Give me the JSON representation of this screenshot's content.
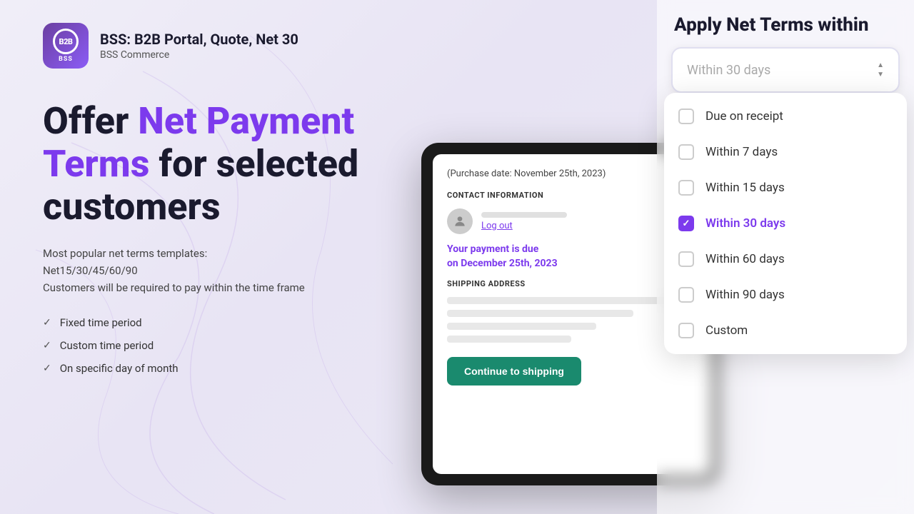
{
  "header": {
    "logo_letters": "B2B",
    "logo_sub": "BSS",
    "app_name": "BSS: B2B Portal, Quote, Net 30",
    "company": "BSS Commerce"
  },
  "hero": {
    "heading_part1": "Offer ",
    "heading_highlight": "Net Payment Terms",
    "heading_part2": " for selected customers",
    "subtext_line1": "Most popular net terms templates:",
    "subtext_line2": "Net15/30/45/60/90",
    "subtext_line3": "Customers will be required to pay within the time frame",
    "features": [
      "Fixed time period",
      "Custom time period",
      "On specific day of month"
    ]
  },
  "tablet": {
    "purchase_date": "(Purchase date: November 25th, 2023)",
    "contact_section": "CONTACT INFORMATION",
    "log_out": "Log out",
    "payment_due_line1": "Your payment is due",
    "payment_due_line2": "on December 25th, 2023",
    "shipping_section": "SHIPPING ADDRESS",
    "continue_btn": "Continue to shipping"
  },
  "dropdown": {
    "title": "Apply Net Terms within",
    "selected_value": "Within 30 days",
    "items": [
      {
        "id": "due-receipt",
        "label": "Due on receipt",
        "checked": false
      },
      {
        "id": "within-7",
        "label": "Within 7 days",
        "checked": false
      },
      {
        "id": "within-15",
        "label": "Within 15 days",
        "checked": false
      },
      {
        "id": "within-30",
        "label": "Within 30 days",
        "checked": true
      },
      {
        "id": "within-60",
        "label": "Within 60 days",
        "checked": false
      },
      {
        "id": "within-90",
        "label": "Within 90 days",
        "checked": false
      },
      {
        "id": "custom",
        "label": "Custom",
        "checked": false
      }
    ]
  },
  "colors": {
    "purple": "#7c3aed",
    "dark": "#1a1a2e",
    "green": "#1a8a6e"
  }
}
